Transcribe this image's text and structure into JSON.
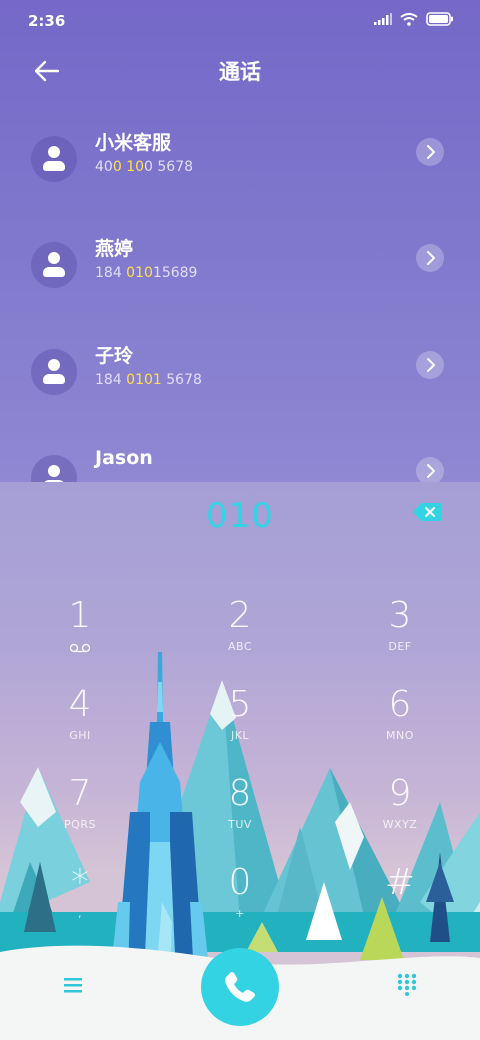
{
  "status": {
    "time": "2:36"
  },
  "header": {
    "title": "通话"
  },
  "contacts": [
    {
      "name": "小米客服",
      "num_parts": [
        "40",
        "0",
        " ",
        "10",
        "0 5678"
      ]
    },
    {
      "name": "燕婷",
      "num_parts": [
        "184 ",
        "010",
        "",
        "",
        "15689"
      ]
    },
    {
      "name": "子玲",
      "num_parts": [
        "184 ",
        "010",
        "",
        "1",
        " 5678"
      ]
    },
    {
      "name": "Jason",
      "num_parts": [
        "",
        "",
        "",
        "",
        ""
      ]
    }
  ],
  "dialpad": {
    "digits": "010",
    "keys": [
      {
        "num": "1",
        "sub": ""
      },
      {
        "num": "2",
        "sub": "ABC"
      },
      {
        "num": "3",
        "sub": "DEF"
      },
      {
        "num": "4",
        "sub": "GHI"
      },
      {
        "num": "5",
        "sub": "JKL"
      },
      {
        "num": "6",
        "sub": "MNO"
      },
      {
        "num": "7",
        "sub": "PQRS"
      },
      {
        "num": "8",
        "sub": "TUV"
      },
      {
        "num": "9",
        "sub": "WXYZ"
      },
      {
        "num": "*",
        "sub": ","
      },
      {
        "num": "0",
        "sub": "+"
      },
      {
        "num": "#",
        "sub": ""
      }
    ]
  },
  "icons": {
    "back": "back-arrow-icon",
    "contact_avatar": "person-icon",
    "contact_detail": "chevron-right-icon",
    "backspace": "backspace-icon",
    "voicemail": "voicemail-icon",
    "menu": "menu-icon",
    "call": "phone-icon",
    "keypad_toggle": "dialpad-icon"
  },
  "colors": {
    "accent": "#33d3e4",
    "highlight": "#ffe04a"
  }
}
